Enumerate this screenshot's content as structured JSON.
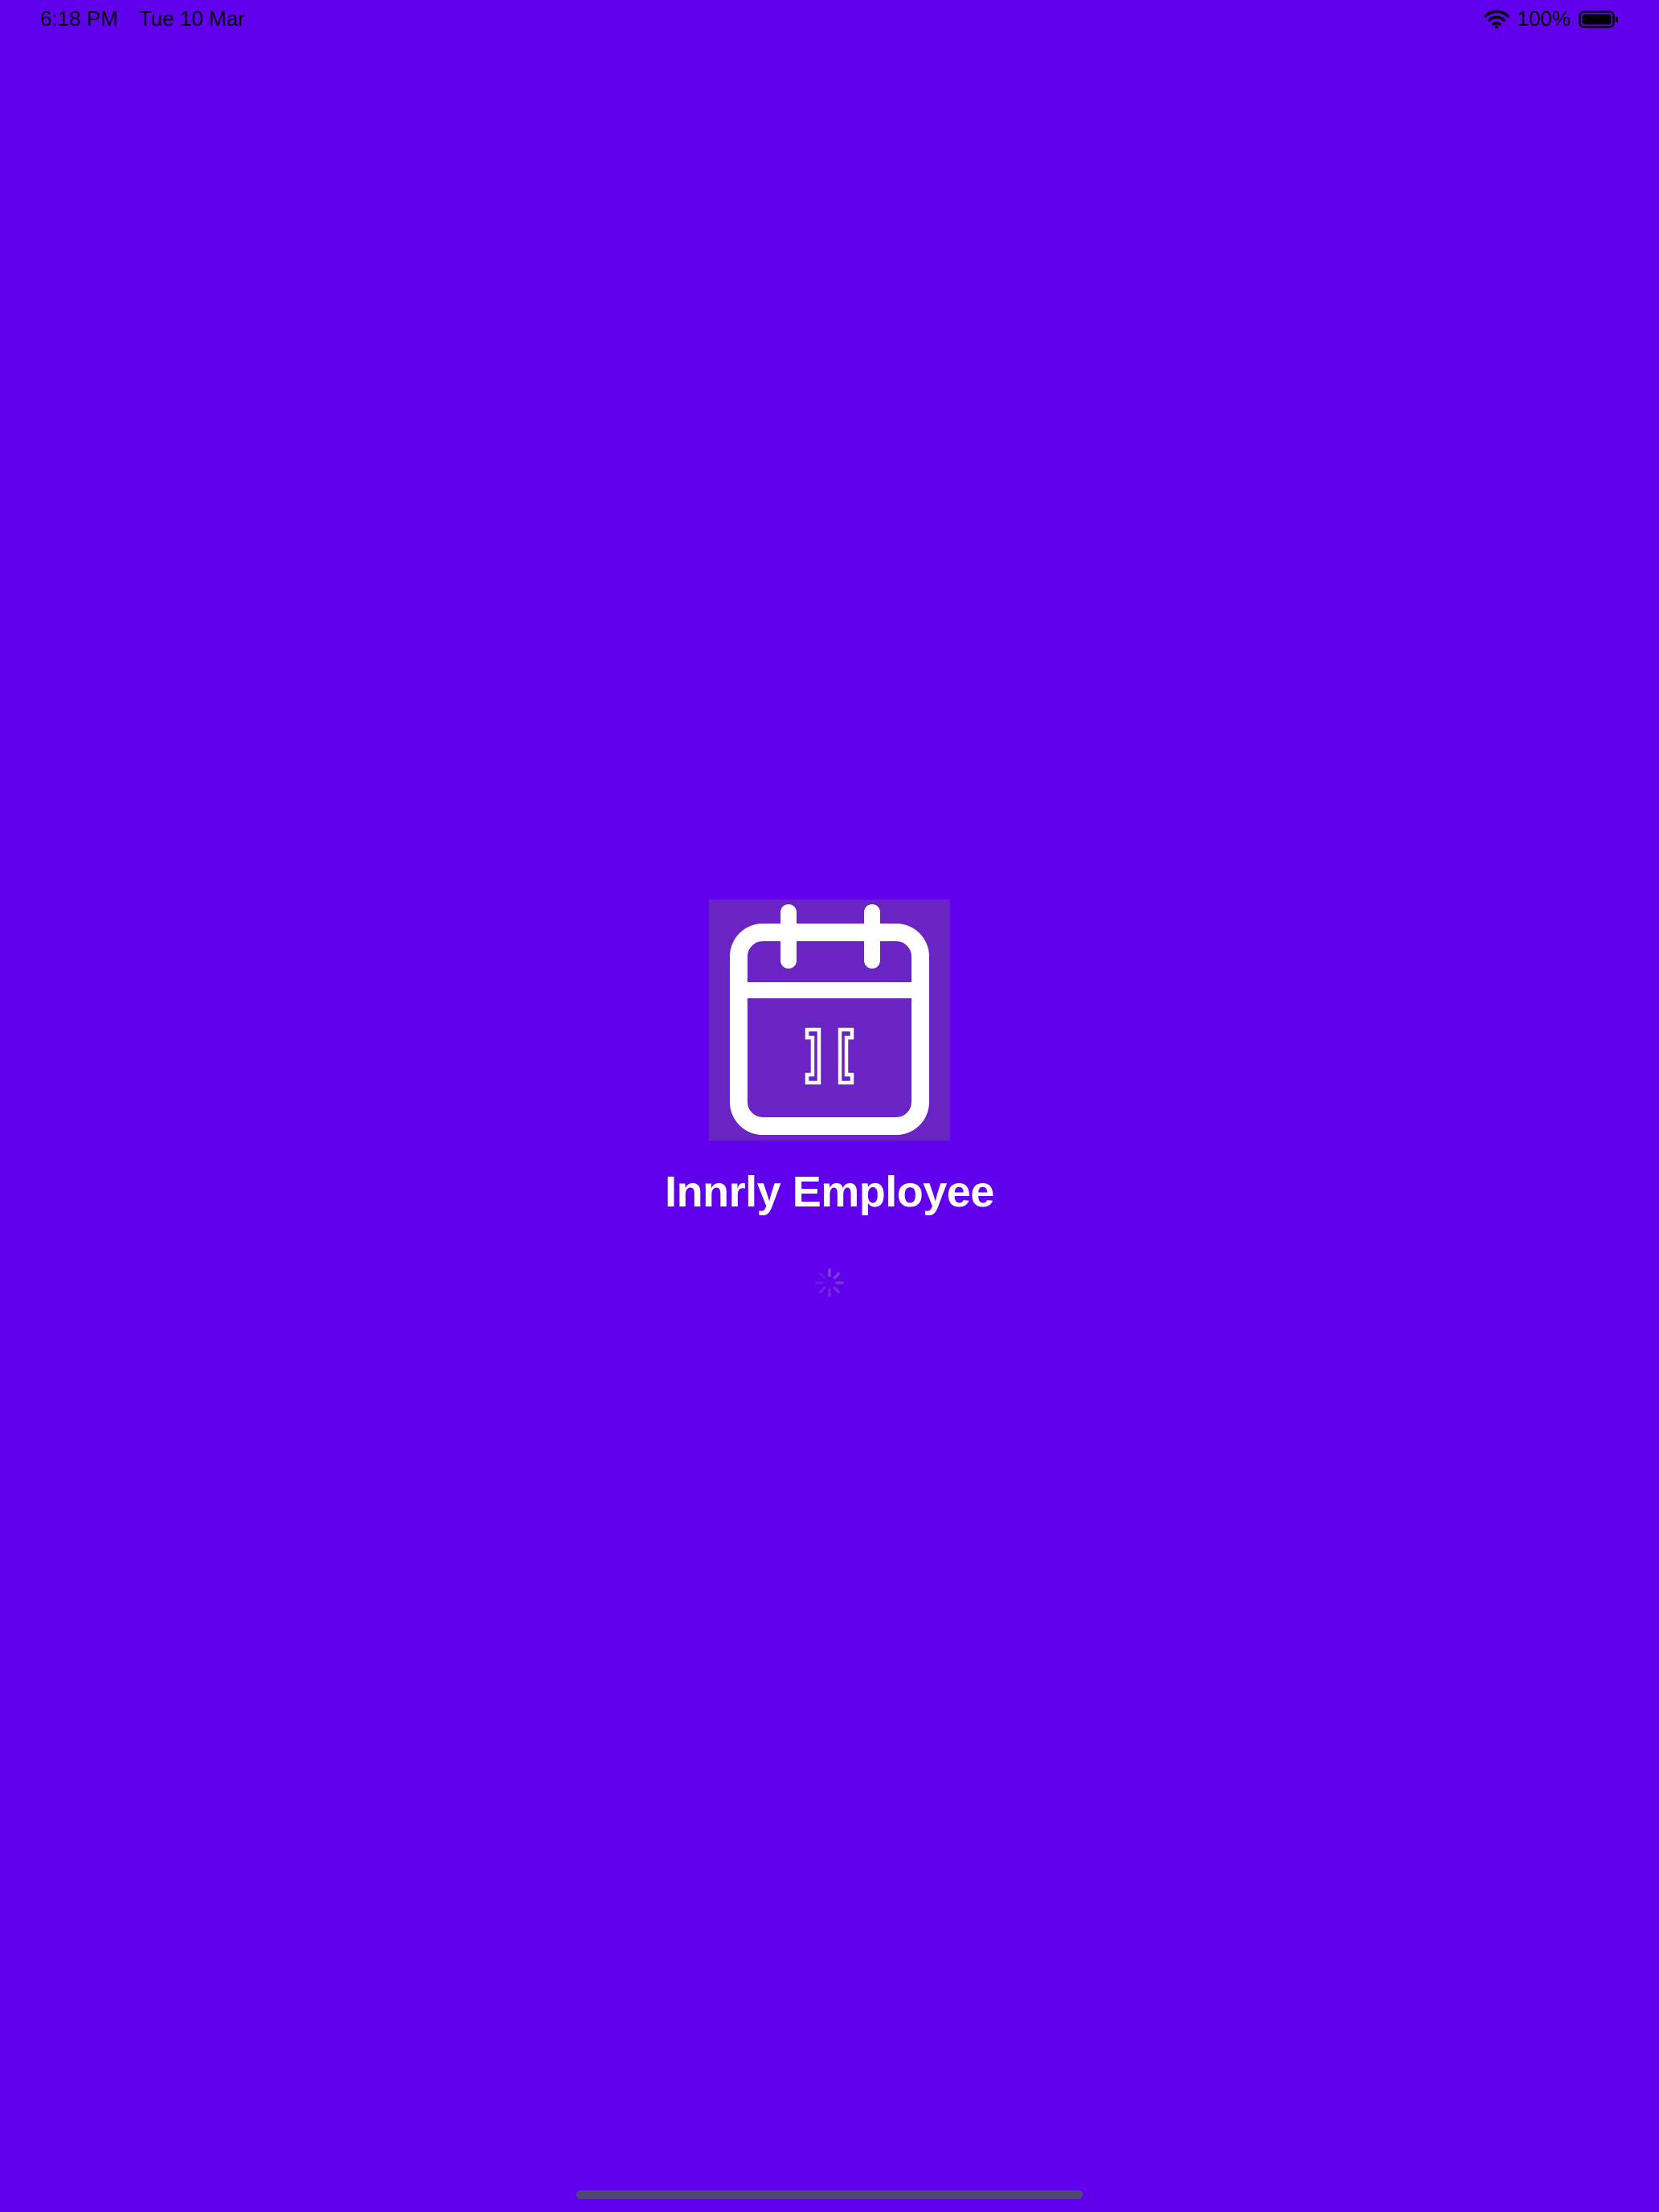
{
  "status_bar": {
    "time": "6:18 PM",
    "date": "Tue 10 Mar",
    "battery_percent": "100%",
    "battery_level": 1.0
  },
  "splash": {
    "app_name": "Innrly Employee",
    "logo_icon": "calendar-icon"
  },
  "colors": {
    "background": "#6000EC",
    "logo_background": "#6A24C4",
    "text": "#FFFFFF",
    "status_text": "#000000"
  }
}
